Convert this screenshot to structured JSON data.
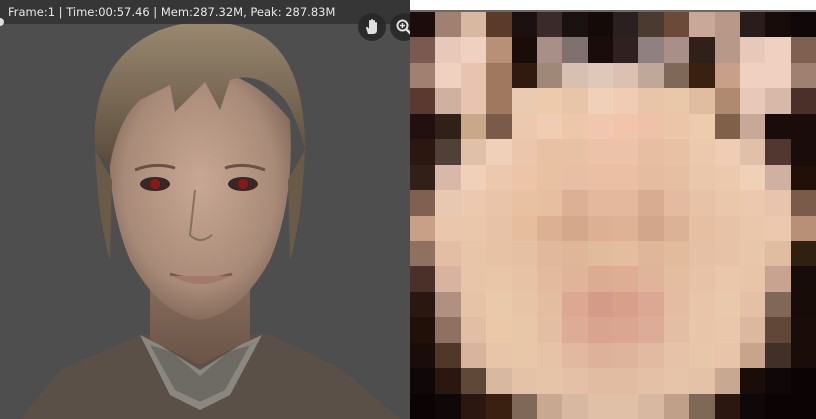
{
  "viewport": {
    "stats": "Frame:1 | Time:00:57.46 | Mem:287.32M, Peak: 287.83M",
    "buttons": [
      {
        "icon": "hand-pan-icon"
      },
      {
        "icon": "zoom-icon"
      }
    ]
  },
  "preview": {
    "grid": [
      [
        "#1c0c0a",
        "#a08070",
        "#d8b8a0",
        "#5a3a28",
        "#1c1010",
        "#3a2a28",
        "#1a1210",
        "#140a08",
        "#2a2020",
        "#4a3a30",
        "#6a4a38",
        "#c8a898",
        "#b89888",
        "#2a1c18",
        "#180c0a",
        "#100808"
      ],
      [
        "#7a5a50",
        "#e8c8b8",
        "#f0d0c0",
        "#b89078",
        "#1a0c08",
        "#a89088",
        "#807070",
        "#1a0c0a",
        "#302020",
        "#908080",
        "#a89088",
        "#302018",
        "#b89888",
        "#e8c8b8",
        "#f0d0c0",
        "#806050"
      ],
      [
        "#a08070",
        "#f0d0c0",
        "#e8c4b0",
        "#a07860",
        "#301a10",
        "#a08878",
        "#d8c0b0",
        "#e0c8b8",
        "#dcc0b0",
        "#c0a898",
        "#806858",
        "#3a2010",
        "#c8a088",
        "#f0d0c0",
        "#f0d0c0",
        "#a08070"
      ],
      [
        "#5a3a30",
        "#d0b0a0",
        "#e8c4b0",
        "#a07860",
        "#e8cbb0",
        "#eecaac",
        "#e8c4a8",
        "#f0d0b8",
        "#f0ccb4",
        "#e8c4a8",
        "#e8c8a8",
        "#e0bca0",
        "#b08a70",
        "#e8c8b8",
        "#d8b8a8",
        "#4a3028"
      ],
      [
        "#201010",
        "#302018",
        "#c8a888",
        "#7a5a48",
        "#ecc8ae",
        "#f0ccb2",
        "#eec6aa",
        "#f0c6ae",
        "#f2c4ac",
        "#eec2a8",
        "#ecc4a8",
        "#eecaae",
        "#806048",
        "#c8a898",
        "#1a0c0a",
        "#1a0c0a"
      ],
      [
        "#2a1810",
        "#504038",
        "#e0c0a8",
        "#f0d0b8",
        "#ecc6ac",
        "#e8c0a4",
        "#e8c0a4",
        "#ecc2a8",
        "#ecc2a8",
        "#e8bea2",
        "#e8c0a4",
        "#ecc8ac",
        "#f0ccb4",
        "#e0c0a8",
        "#503830",
        "#1a0c0a"
      ],
      [
        "#302018",
        "#d8b8a8",
        "#f0d0b8",
        "#ecc8ae",
        "#eec4a8",
        "#e8c0a2",
        "#e8bea4",
        "#eabfa4",
        "#eabfa4",
        "#e6bca0",
        "#e6bea2",
        "#eac6aa",
        "#ecc8ac",
        "#f0d0b8",
        "#d0b0a0",
        "#201008"
      ],
      [
        "#806050",
        "#e8c8b0",
        "#ecc8ae",
        "#eac4a8",
        "#e8c0a2",
        "#e6bea0",
        "#dcb094",
        "#e4b89c",
        "#e4b89c",
        "#d8ac90",
        "#e4baa0",
        "#e8c2a6",
        "#eac6aa",
        "#ecc8ae",
        "#e8c4ac",
        "#7a5a48"
      ],
      [
        "#c8a088",
        "#eac6ac",
        "#eac6aa",
        "#e8c2a6",
        "#e6be9e",
        "#dcb092",
        "#d4a88a",
        "#dcb092",
        "#deb294",
        "#d2a68a",
        "#dcb296",
        "#e6bea2",
        "#e8c2a6",
        "#eac6aa",
        "#ecc8ae",
        "#b89078"
      ],
      [
        "#907060",
        "#e4bea4",
        "#e8c4a8",
        "#e8c2a4",
        "#e6c0a2",
        "#e2b89c",
        "#e0b698",
        "#e2ba9c",
        "#e4bc9e",
        "#e0b69a",
        "#e2ba9c",
        "#e6c0a4",
        "#e8c2a6",
        "#e8c6aa",
        "#e0bca0",
        "#302010"
      ],
      [
        "#4a3028",
        "#d8b4a0",
        "#e8c4a8",
        "#eac6a8",
        "#e8c2a4",
        "#e4ba9e",
        "#e0b498",
        "#dcac92",
        "#deae94",
        "#e0b49a",
        "#e4bca0",
        "#e8c2a6",
        "#eac6aa",
        "#e8c4a8",
        "#c8a490",
        "#180c08"
      ],
      [
        "#2a1810",
        "#b09080",
        "#e6c2a6",
        "#eac8aa",
        "#e8c4a6",
        "#e4bca0",
        "#dca892",
        "#d49c88",
        "#d8a08a",
        "#dca894",
        "#e4bca2",
        "#e8c4a8",
        "#eac8ac",
        "#e4c0a6",
        "#806858",
        "#180c08"
      ],
      [
        "#201008",
        "#907060",
        "#e2bea4",
        "#eac8a8",
        "#e8c6a8",
        "#e4bea2",
        "#dcac96",
        "#d8a490",
        "#daa692",
        "#dcac98",
        "#e4bea4",
        "#e8c4a8",
        "#eac6aa",
        "#dcb8a0",
        "#604838",
        "#1a0c08"
      ],
      [
        "#1a0c08",
        "#503828",
        "#d8b49c",
        "#e8c4a8",
        "#e8c6a8",
        "#e6c2a6",
        "#e2b8a0",
        "#deb29a",
        "#dfb49c",
        "#e2baa2",
        "#e6c2a8",
        "#e8c6aa",
        "#e8c4aa",
        "#c8a48c",
        "#403028",
        "#1a0c08"
      ],
      [
        "#100808",
        "#2a1810",
        "#604838",
        "#d8b8a0",
        "#e4c2a8",
        "#e6c4a8",
        "#e4c0a6",
        "#e2bca2",
        "#e2bca2",
        "#e4c0a6",
        "#e6c4aa",
        "#e4c2a8",
        "#c8a890",
        "#1a0c08",
        "#100808",
        "#0c0404"
      ],
      [
        "#0c0404",
        "#100808",
        "#2a1810",
        "#3a2010",
        "#806858",
        "#c8a890",
        "#d8b8a0",
        "#e0c0a6",
        "#e0c0a6",
        "#d8b8a0",
        "#c0a088",
        "#806858",
        "#2a1810",
        "#100808",
        "#0c0404",
        "#0c0404"
      ]
    ]
  }
}
